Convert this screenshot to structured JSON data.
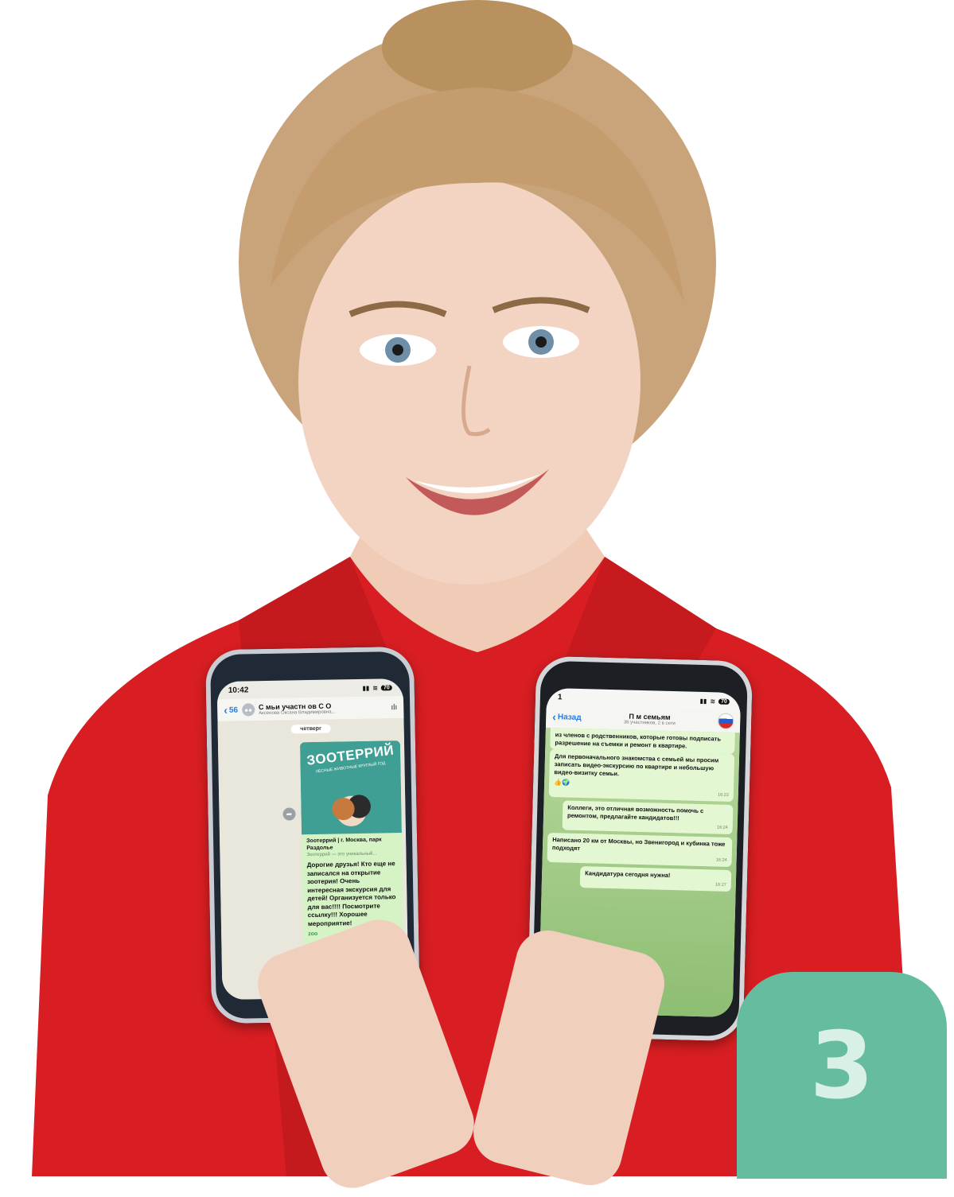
{
  "colors": {
    "jacket": "#d81e22",
    "skin": "#f1cfbd",
    "hair": "#c9a37a",
    "badge_bg": "#66bc9e",
    "badge_text": "#d9f0e6"
  },
  "left_phone": {
    "status_time": "10:42",
    "battery": "70",
    "back_label": "56",
    "chat_title": "С  мьи участн  ов С  О",
    "chat_subtitle": "Аксенова Оксана Владимировна...",
    "day_label": "четверг",
    "post_logo": "ЗООТЕРРИЙ",
    "post_tagline": "ЛЕСНЫЕ ЖИВОТНЫЕ КРУГЛЫЙ ГОД",
    "link_title": "Зоотеррий | г. Москва, парк Раздолье",
    "link_desc": "Зоотеррий — это уникальный...",
    "post_text": "Дорогие друзья! Кто еще не записался на открытие зоотерия! Очень интересная экскурсия для детей! Организуется только для вас!!!! Посмотрите ссылку!!! Хорошее мероприятие!",
    "post_link": "zoo"
  },
  "right_phone": {
    "status_time": "1",
    "battery": "70",
    "back_label": "Назад",
    "chat_title": "П  м      семьям",
    "chat_subtitle": "36 участников, 2 в сети",
    "messages": [
      {
        "text": "из членов с              родственников, которые готовы подписать разрешение на съемки и ремонт в квартире.",
        "time": ""
      },
      {
        "text": "Для первоначального знакомства с семьей мы просим записать видео-экскурсию по квартире и небольшую видео-визитку семьи.",
        "time": "16:22"
      },
      {
        "text": "Коллеги, это отличная возможность помочь с ремонтом, предлагайте кандидатов!!!",
        "time": "16:24"
      },
      {
        "text": "Написано 20 км от Москвы, но Звенигород и кубинка тоже подходят",
        "time": "16:24"
      },
      {
        "text": "Кандидатура сегодня нужна!",
        "time": "16:27"
      }
    ]
  },
  "badge": {
    "number": "3"
  }
}
